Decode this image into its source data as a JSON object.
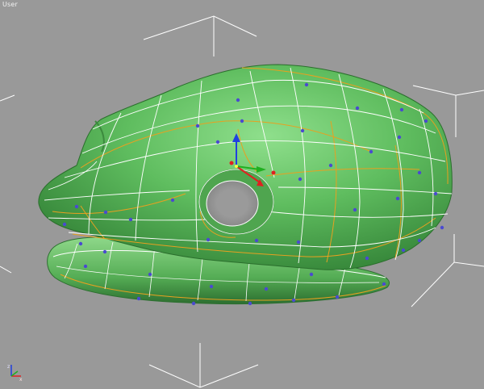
{
  "viewport": {
    "label": "User",
    "background": "#999999"
  },
  "model": {
    "surface_color": "#5fbd5f",
    "wire_color": "#ffffff",
    "cage_color": "#e8a020",
    "vertex_color": "#4a4ad0"
  },
  "gizmo": {
    "x_color": "#e02020",
    "y_color": "#20b020",
    "z_color": "#2040e0"
  },
  "axis_tripod": {
    "icon": "world-axis-icon"
  }
}
